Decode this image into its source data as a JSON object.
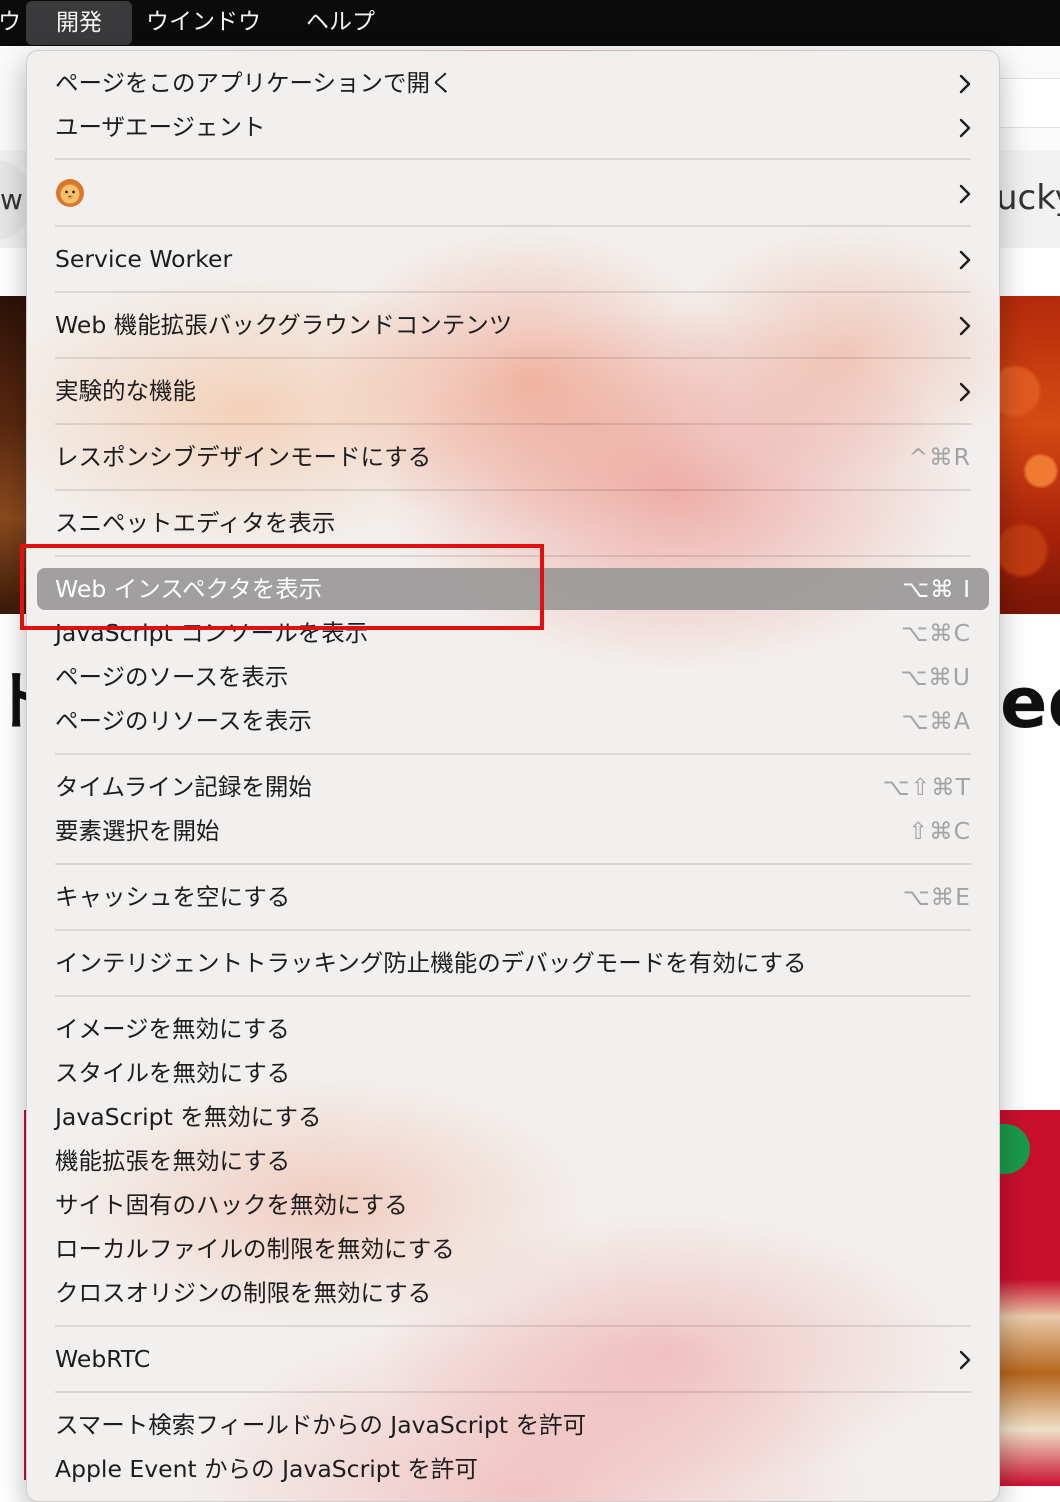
{
  "menubar": {
    "items": [
      {
        "label": "ウ"
      },
      {
        "label": "開発"
      },
      {
        "label": "ウインドウ"
      },
      {
        "label": "ヘルプ"
      }
    ]
  },
  "background": {
    "left_fragment": "w",
    "right_fragment": "ucky",
    "big_left": "ド",
    "big_right": "ed"
  },
  "menu": {
    "items": [
      {
        "label": "ページをこのアプリケーションで開く",
        "submenu": true
      },
      {
        "label": "ユーザエージェント",
        "submenu": true
      },
      {
        "label": "",
        "icon": "lion-emoji-icon",
        "submenu": true
      },
      {
        "label": "Service Worker",
        "submenu": true
      },
      {
        "label": "Web 機能拡張バックグラウンドコンテンツ",
        "submenu": true
      },
      {
        "label": "実験的な機能",
        "submenu": true
      },
      {
        "label": "レスポンシブデザインモードにする",
        "shortcut": "^⌘R"
      },
      {
        "label": "スニペットエディタを表示"
      },
      {
        "label": "Web インスペクタを表示",
        "shortcut": "⌥⌘ I",
        "highlighted": true
      },
      {
        "label": "JavaScript コンソールを表示",
        "shortcut": "⌥⌘C"
      },
      {
        "label": "ページのソースを表示",
        "shortcut": "⌥⌘U"
      },
      {
        "label": "ページのリソースを表示",
        "shortcut": "⌥⌘A"
      },
      {
        "label": "タイムライン記録を開始",
        "shortcut": "⌥⇧⌘T"
      },
      {
        "label": "要素選択を開始",
        "shortcut": "⇧⌘C"
      },
      {
        "label": "キャッシュを空にする",
        "shortcut": "⌥⌘E"
      },
      {
        "label": "インテリジェントトラッキング防止機能のデバッグモードを有効にする"
      },
      {
        "label": "イメージを無効にする"
      },
      {
        "label": "スタイルを無効にする"
      },
      {
        "label": "JavaScript を無効にする"
      },
      {
        "label": "機能拡張を無効にする"
      },
      {
        "label": "サイト固有のハックを無効にする"
      },
      {
        "label": "ローカルファイルの制限を無効にする"
      },
      {
        "label": "クロスオリジンの制限を無効にする"
      },
      {
        "label": "WebRTC",
        "submenu": true
      },
      {
        "label": "スマート検索フィールドからの JavaScript を許可"
      },
      {
        "label": "Apple Event からの JavaScript を許可"
      }
    ]
  },
  "colors": {
    "highlight": "#9a9898",
    "annotation_box": "#e01010",
    "shortcut_text": "#a3a3a6"
  }
}
